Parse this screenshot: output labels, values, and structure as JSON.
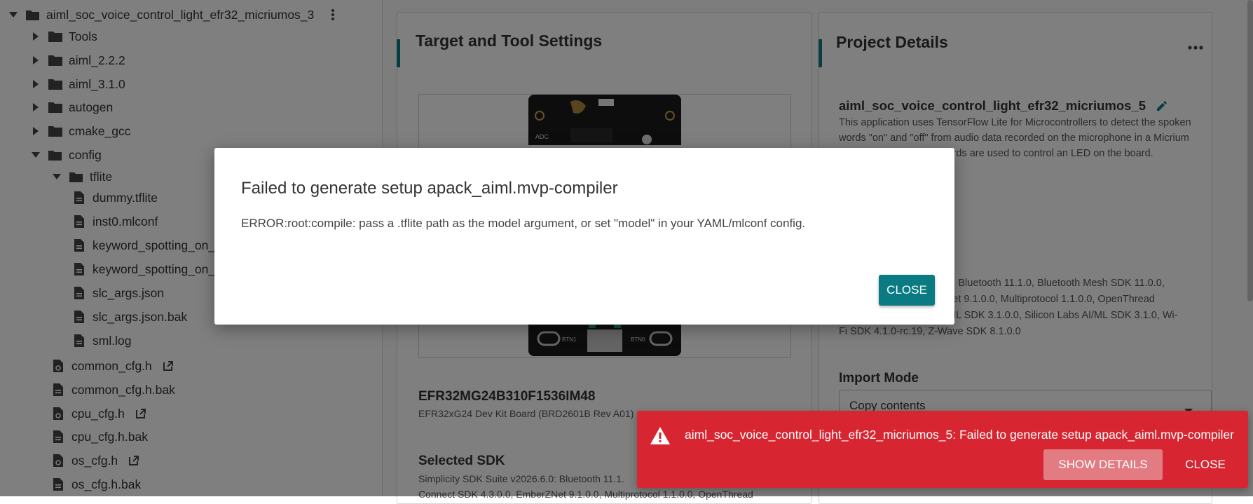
{
  "sidebar": {
    "project": {
      "label": "aiml_soc_voice_control_light_efr32_micriumos_3"
    },
    "items": [
      {
        "label": "Tools"
      },
      {
        "label": "aiml_2.2.2"
      },
      {
        "label": "aiml_3.1.0"
      },
      {
        "label": "autogen"
      },
      {
        "label": "cmake_gcc"
      },
      {
        "label": "config"
      },
      {
        "label": "tflite"
      },
      {
        "label": "dummy.tflite"
      },
      {
        "label": "inst0.mlconf"
      },
      {
        "label": "keyword_spotting_on_c"
      },
      {
        "label": "keyword_spotting_on_c"
      },
      {
        "label": "slc_args.json"
      },
      {
        "label": "slc_args.json.bak"
      },
      {
        "label": "sml.log"
      },
      {
        "label": "common_cfg.h"
      },
      {
        "label": "common_cfg.h.bak"
      },
      {
        "label": "cpu_cfg.h"
      },
      {
        "label": "cpu_cfg.h.bak"
      },
      {
        "label": "os_cfg.h"
      },
      {
        "label": "os_cfg.h.bak"
      }
    ]
  },
  "target_card": {
    "title": "Target and Tool Settings",
    "board_name": "EFR32MG24B310F1536IM48",
    "board_desc": "EFR32xG24 Dev Kit Board (BRD2601B Rev A01)",
    "board_labels": {
      "adc": "ADC",
      "btn1": "BTN1",
      "btn0": "BTN0"
    },
    "sdk_heading": "Selected SDK",
    "sdk_line1": "Simplicity SDK Suite v2026.6.0: Bluetooth 11.1.",
    "sdk_line2": "Connect SDK 4.3.0.0, EmberZNet 9.1.0.0, Multiprotocol 1.1.0.0, OpenThread"
  },
  "project_card": {
    "title": "Project Details",
    "project_name": "aiml_soc_voice_control_light_efr32_micriumos_5",
    "description_lines": [
      "This application uses TensorFlow Lite for Microcontrollers to detect the spoken",
      "words \"on\" and \"off\" from audio data recorded on the microphone in a Micrium",
      "cted keywords are used to control an LED on the board."
    ],
    "sdk_lines": [
      "26.6.0: Bluetooth 11.1.0, Bluetooth Mesh SDK 11.0.0,",
      "berZNet 9.1.0.0, Multiprotocol 1.1.0.0, OpenThread",
      "6), RAIL SDK 3.1.0.0, Silicon Labs AI/ML SDK 3.1.0, Wi-",
      "Fi SDK 4.1.0-rc.19, Z-Wave SDK 8.1.0.0"
    ],
    "import_mode_label": "Import Mode",
    "import_mode_value": "Copy contents"
  },
  "modal": {
    "title": "Failed to generate setup apack_aiml.mvp-compiler",
    "body": "ERROR:root:compile: pass a .tflite path as the model argument, or set \"model\" in your YAML/mlconf config.",
    "close_label": "CLOSE"
  },
  "toast": {
    "message": "aiml_soc_voice_control_light_efr32_micriumos_5: Failed to generate setup apack_aiml.mvp-compiler",
    "show_details_label": "SHOW DETAILS",
    "close_label": "CLOSE"
  },
  "colors": {
    "accent": "#0a7b83",
    "error": "#d72631"
  }
}
